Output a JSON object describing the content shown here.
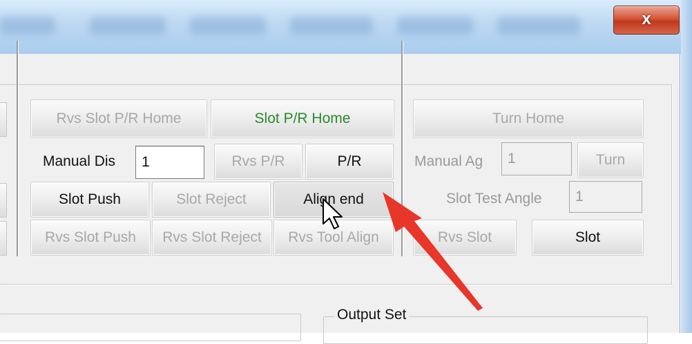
{
  "window": {
    "close_label": "x"
  },
  "buttons": {
    "rvs_slot_pr_home": "Rvs Slot P/R Home",
    "slot_pr_home": "Slot P/R Home",
    "turn_home": "Turn Home",
    "rvs_pr": "Rvs P/R",
    "pr": "P/R",
    "turn": "Turn",
    "slot_push": "Slot Push",
    "slot_reject": "Slot Reject",
    "align_end": "Align end",
    "rvs_slot_push": "Rvs Slot Push",
    "rvs_slot_reject": "Rvs Slot Reject",
    "rvs_tool_align": "Rvs Tool Align",
    "rvs_slot": "Rvs Slot",
    "slot": "Slot"
  },
  "fields": {
    "manual_dis_label": "Manual Dis",
    "manual_dis_value": "1",
    "manual_ag_label": "Manual Ag",
    "manual_ag_value": "1",
    "slot_test_angle_label": "Slot Test Angle",
    "slot_test_angle_value": "1"
  },
  "groups": {
    "output_set": "Output Set"
  },
  "colors": {
    "green_text": "#2a8a2a",
    "disabled_text": "#a8a8a8",
    "close_red": "#c0391d",
    "arrow_red": "#e8362a"
  },
  "icons": {
    "cursor": "arrow-pointer-icon",
    "annotation": "red-arrow-icon"
  }
}
